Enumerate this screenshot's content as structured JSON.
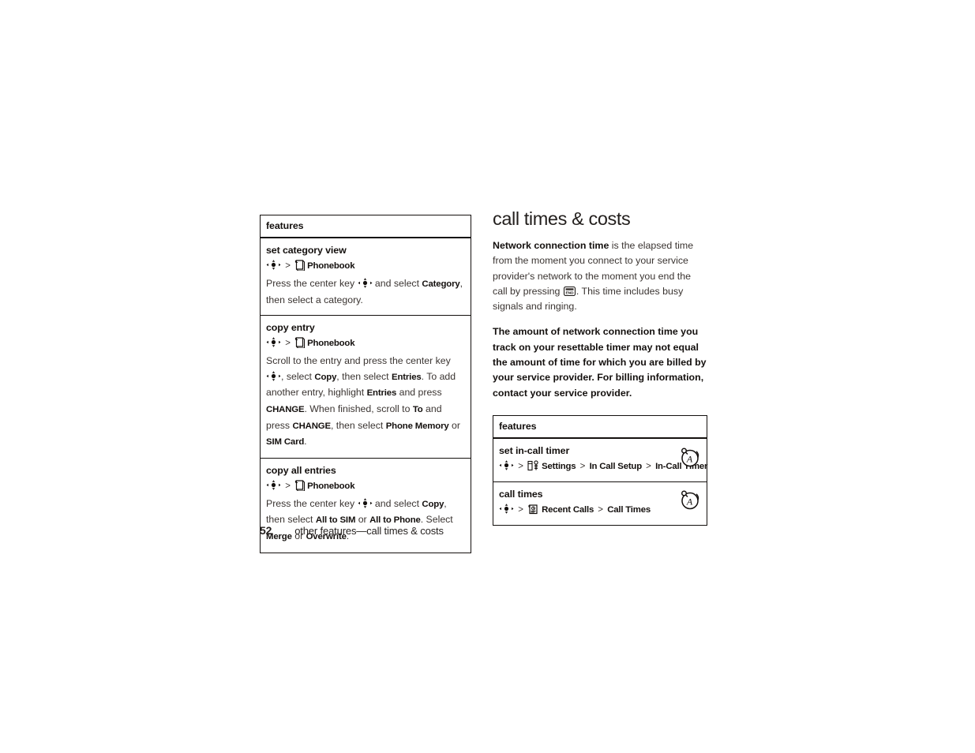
{
  "document": {
    "page_number": "52",
    "footer_text": "other features—call times & costs"
  },
  "left_table": {
    "header": "features",
    "rows": [
      {
        "title": "set category view",
        "path_icon": "phonebook-icon",
        "path_label": "Phonebook",
        "body_segments": [
          {
            "t": "Press the center key ",
            "kw": false
          },
          {
            "t": "NAVKEY",
            "kw": false,
            "icon": "nav-key-icon"
          },
          {
            "t": " and select ",
            "kw": false
          },
          {
            "t": "Category",
            "kw": true
          },
          {
            "t": ", then select a category.",
            "kw": false
          }
        ]
      },
      {
        "title": "copy entry",
        "path_icon": "phonebook-icon",
        "path_label": "Phonebook",
        "body_segments": [
          {
            "t": "Scroll to the entry and press the center key ",
            "kw": false
          },
          {
            "t": "NAVKEY",
            "kw": false,
            "icon": "nav-key-icon"
          },
          {
            "t": ", select ",
            "kw": false
          },
          {
            "t": "Copy",
            "kw": true
          },
          {
            "t": ", then select ",
            "kw": false
          },
          {
            "t": "Entries",
            "kw": true
          },
          {
            "t": ". To add another entry, highlight ",
            "kw": false
          },
          {
            "t": "Entries",
            "kw": true
          },
          {
            "t": " and press ",
            "kw": false
          },
          {
            "t": "CHANGE",
            "kw": true
          },
          {
            "t": ". When finished, scroll to ",
            "kw": false
          },
          {
            "t": "To",
            "kw": true
          },
          {
            "t": " and press ",
            "kw": false
          },
          {
            "t": "CHANGE",
            "kw": true
          },
          {
            "t": ", then select ",
            "kw": false
          },
          {
            "t": "Phone Memory",
            "kw": true
          },
          {
            "t": " or ",
            "kw": false
          },
          {
            "t": "SIM Card",
            "kw": true
          },
          {
            "t": ".",
            "kw": false
          }
        ]
      },
      {
        "title": "copy all entries",
        "path_icon": "phonebook-icon",
        "path_label": "Phonebook",
        "body_segments": [
          {
            "t": "Press the center key ",
            "kw": false
          },
          {
            "t": "NAVKEY",
            "kw": false,
            "icon": "nav-key-icon"
          },
          {
            "t": " and select ",
            "kw": false
          },
          {
            "t": "Copy",
            "kw": true
          },
          {
            "t": ", then select ",
            "kw": false
          },
          {
            "t": "All to SIM",
            "kw": true
          },
          {
            "t": " or ",
            "kw": false
          },
          {
            "t": "All to Phone",
            "kw": true
          },
          {
            "t": ". Select ",
            "kw": false
          },
          {
            "t": "Merge",
            "kw": true
          },
          {
            "t": " or ",
            "kw": false
          },
          {
            "t": "Overwrite",
            "kw": true
          },
          {
            "t": ".",
            "kw": false
          }
        ]
      }
    ]
  },
  "right_column": {
    "heading": "call times & costs",
    "paragraph_1": {
      "lead": "Network connection time",
      "rest_a": " is the elapsed time from the moment you connect to your service provider's network to the moment you end the call by pressing ",
      "key_icon_label": "END",
      "rest_b": ". This time includes busy signals and ringing."
    },
    "paragraph_2": "The amount of network connection time you track on your resettable timer may not equal the amount of time for which you are billed by your service provider. For billing information, contact your service provider."
  },
  "right_table": {
    "header": "features",
    "rows": [
      {
        "title": "set in-call timer",
        "badge_icon": "alarm-clock-icon",
        "path": [
          {
            "type": "navkey"
          },
          {
            "type": "gt",
            "t": ">"
          },
          {
            "type": "icon",
            "icon": "settings-icon"
          },
          {
            "type": "label",
            "t": "Settings"
          },
          {
            "type": "gt",
            "t": ">"
          },
          {
            "type": "label",
            "t": "In Call Setup"
          },
          {
            "type": "gt",
            "t": ">"
          },
          {
            "type": "label",
            "t": "In-Call Timer"
          }
        ]
      },
      {
        "title": "call times",
        "badge_icon": "alarm-clock-icon",
        "path": [
          {
            "type": "navkey"
          },
          {
            "type": "gt",
            "t": ">"
          },
          {
            "type": "icon",
            "icon": "recent-calls-icon"
          },
          {
            "type": "label",
            "t": "Recent Calls"
          },
          {
            "type": "gt",
            "t": ">"
          },
          {
            "type": "label",
            "t": "Call Times"
          }
        ]
      }
    ]
  },
  "colors": {
    "ink": "#231f1d",
    "rule": "#14100e",
    "body": "#3a3431"
  }
}
